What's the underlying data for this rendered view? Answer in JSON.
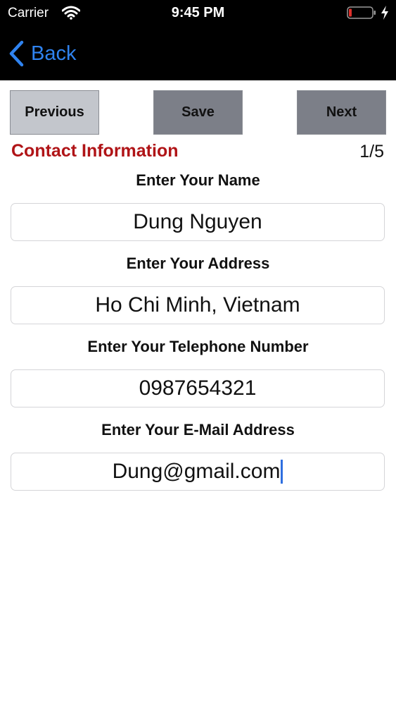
{
  "status_bar": {
    "carrier": "Carrier",
    "time": "9:45 PM"
  },
  "nav": {
    "back_label": "Back"
  },
  "toolbar": {
    "previous_label": "Previous",
    "save_label": "Save",
    "next_label": "Next"
  },
  "section": {
    "title": "Contact Information",
    "page_indicator": "1/5"
  },
  "fields": [
    {
      "label": "Enter Your Name",
      "value": "Dung Nguyen"
    },
    {
      "label": "Enter Your Address",
      "value": "Ho Chi Minh, Vietnam"
    },
    {
      "label": "Enter Your Telephone Number",
      "value": "0987654321"
    },
    {
      "label": "Enter Your E-Mail Address",
      "value": "Dung@gmail.com"
    }
  ],
  "colors": {
    "accent_blue": "#2f83f0",
    "section_red": "#b01417",
    "battery_low_red": "#e0302b"
  }
}
